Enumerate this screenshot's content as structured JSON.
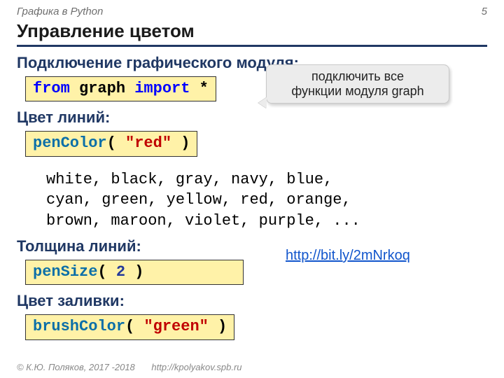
{
  "top": {
    "left": "Графика в Python",
    "pageno": "5"
  },
  "title": "Управление цветом",
  "sections": {
    "import_label": "Подключение графического модуля:",
    "pen_color_label": "Цвет линий:",
    "pen_size_label": "Толщина линий:",
    "brush_color_label": "Цвет заливки:"
  },
  "code": {
    "import": {
      "kw1": "from",
      "mod": " graph ",
      "kw2": "import",
      "star": " *"
    },
    "pencolor": {
      "fn": "penColor",
      "open": "( ",
      "arg": "\"red\"",
      "close": " )"
    },
    "pensize": {
      "fn": "penSize",
      "open": "( ",
      "arg": "2",
      "close": " )"
    },
    "brushcolor": {
      "fn": "brushColor",
      "open": "( ",
      "arg": "\"green\"",
      "close": " )"
    }
  },
  "callout": {
    "line1": "подключить все",
    "line2": "функции модуля graph"
  },
  "color_list": {
    "l1": "white, black, gray, navy, blue,",
    "l2": "cyan, green, yellow, red, orange,",
    "l3": "brown, maroon, violet, purple, ..."
  },
  "link": "http://bit.ly/2mNrkoq",
  "footer": {
    "copyright": "© К.Ю. Поляков, 2017 -2018",
    "url": "http://kpolyakov.spb.ru"
  }
}
